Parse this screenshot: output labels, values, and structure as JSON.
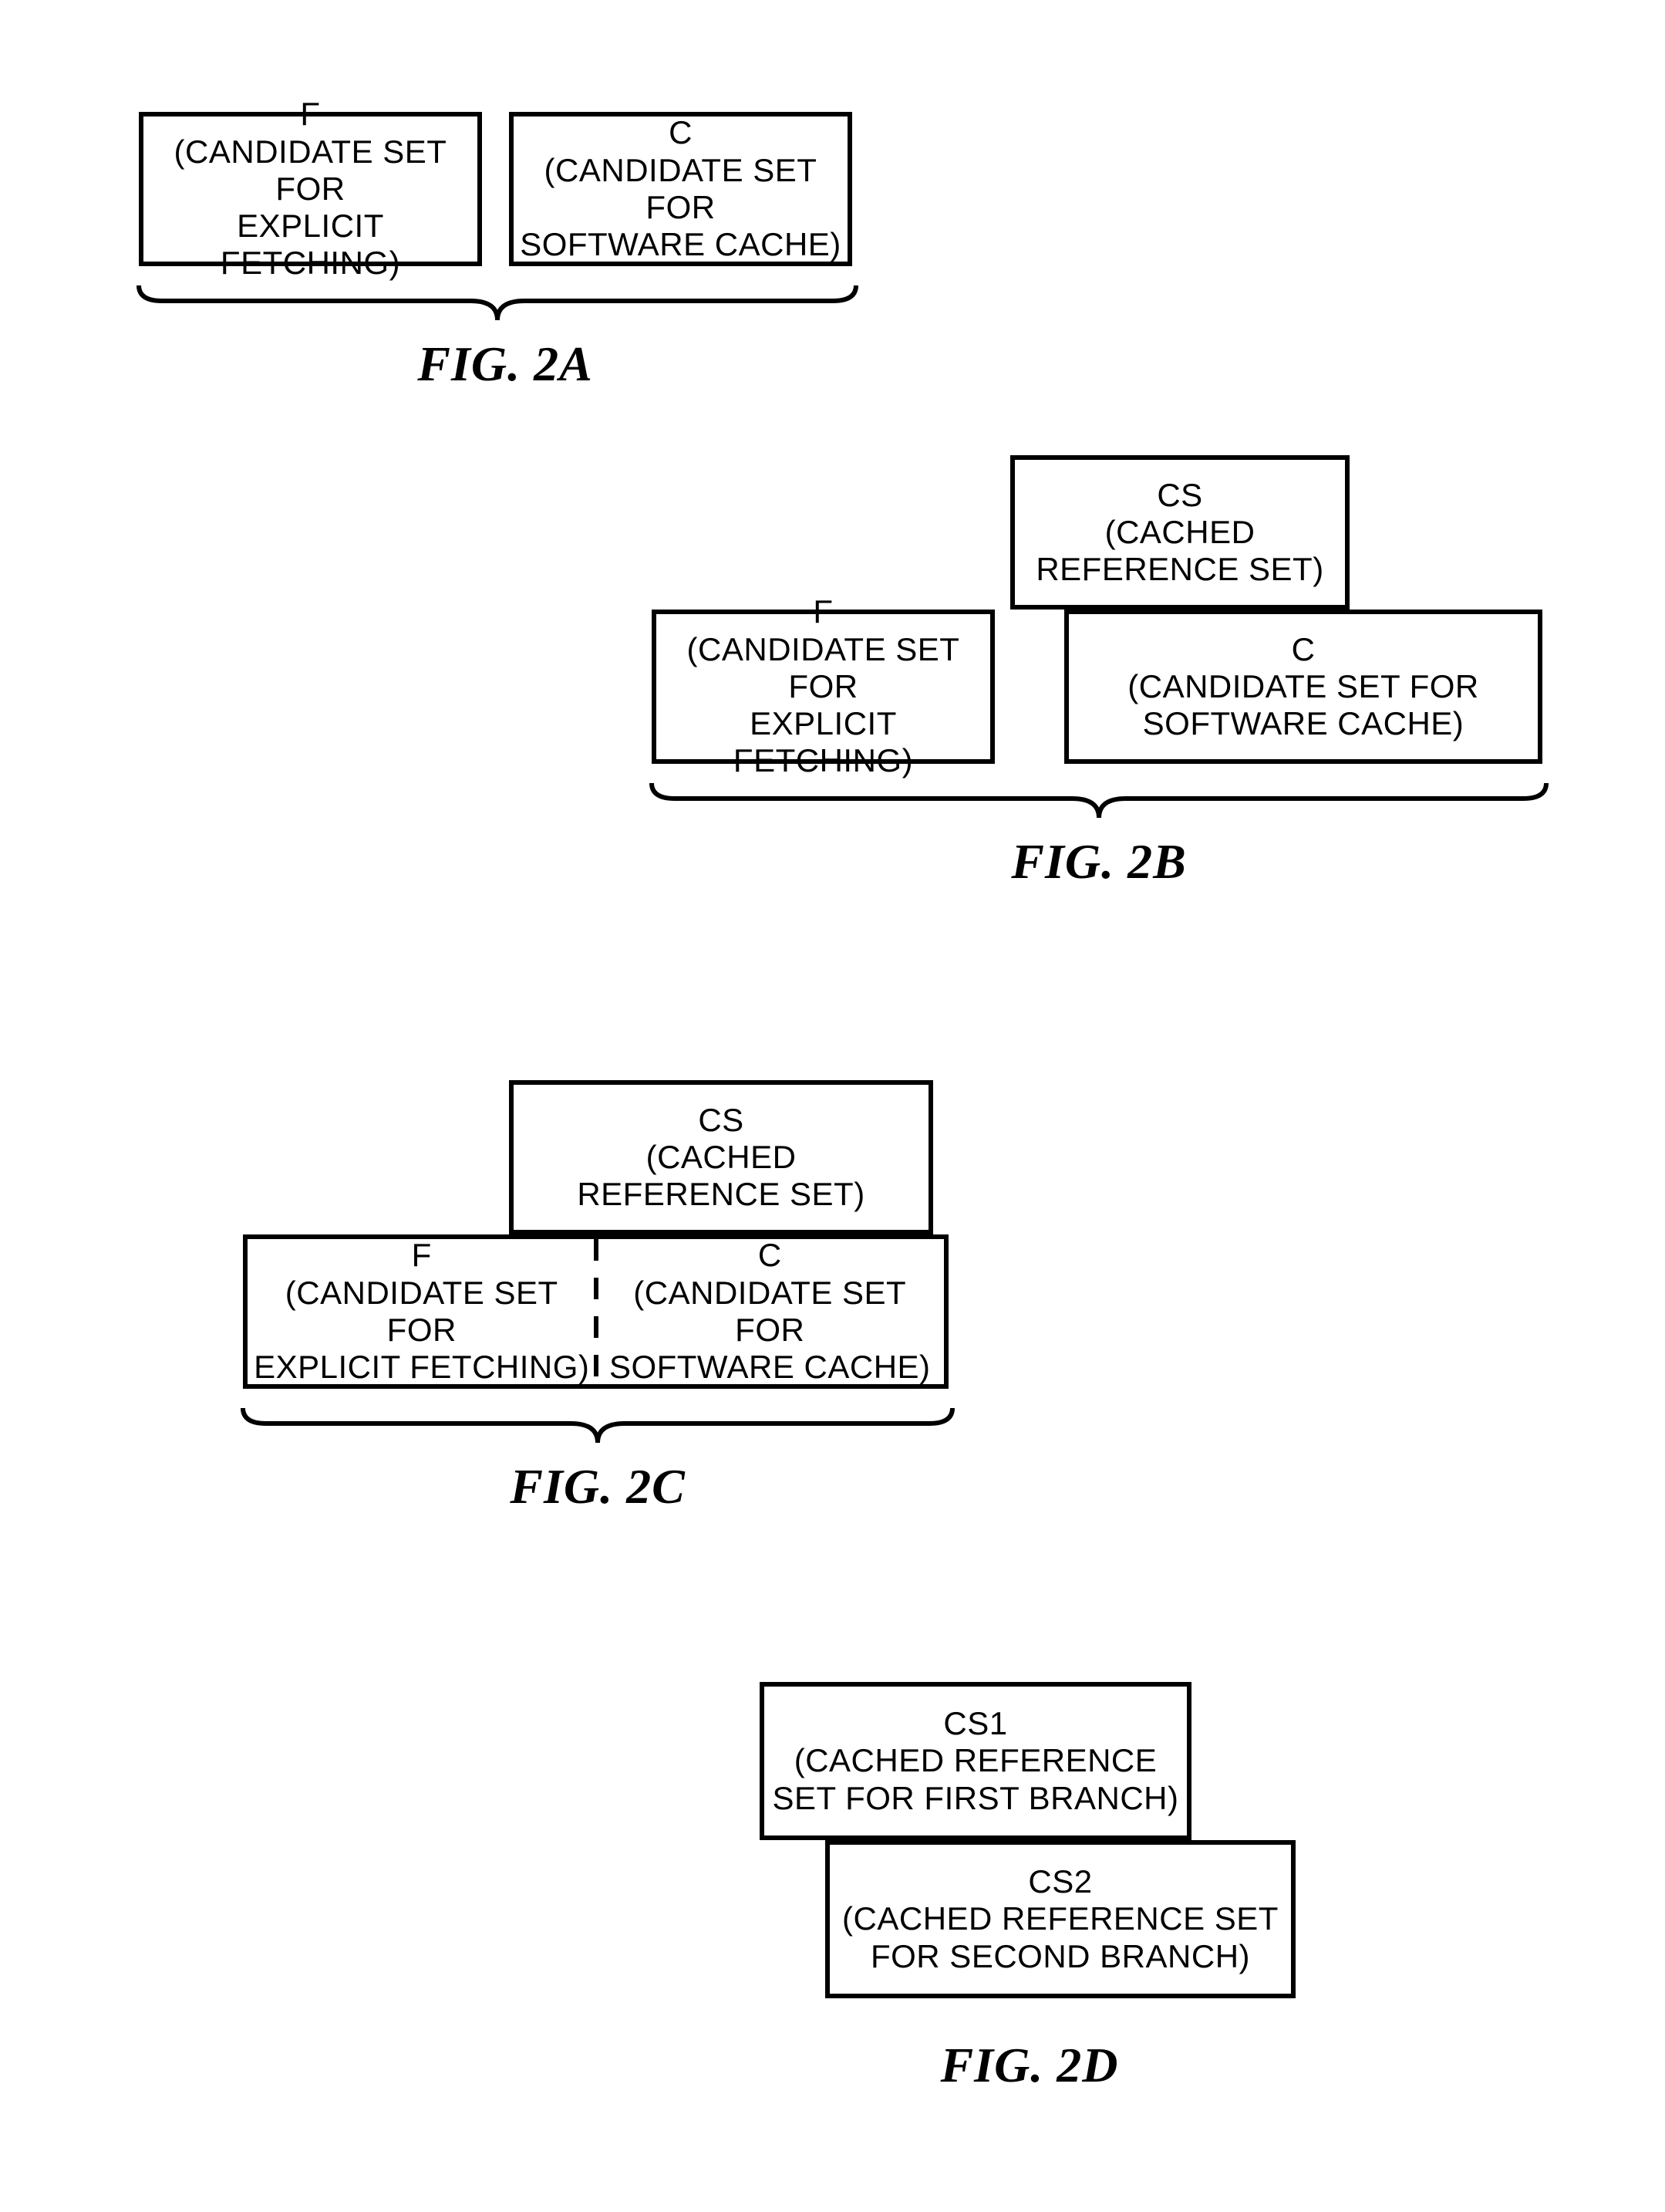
{
  "fig2a": {
    "caption": "FIG. 2A",
    "boxF": {
      "title": "F",
      "sub": "(CANDIDATE SET FOR\nEXPLICIT FETCHING)"
    },
    "boxC": {
      "title": "C",
      "sub": "(CANDIDATE SET FOR\nSOFTWARE CACHE)"
    }
  },
  "fig2b": {
    "caption": "FIG. 2B",
    "boxCS": {
      "title": "CS",
      "sub": "(CACHED\nREFERENCE SET)"
    },
    "boxF": {
      "title": "F",
      "sub": "(CANDIDATE SET FOR\nEXPLICIT FETCHING)"
    },
    "boxC": {
      "title": "C",
      "sub": "(CANDIDATE SET FOR\nSOFTWARE CACHE)"
    }
  },
  "fig2c": {
    "caption": "FIG. 2C",
    "boxCS": {
      "title": "CS",
      "sub": "(CACHED\nREFERENCE SET)"
    },
    "boxF": {
      "title": "F",
      "sub": "(CANDIDATE SET FOR\nEXPLICIT FETCHING)"
    },
    "boxC": {
      "title": "C",
      "sub": "(CANDIDATE SET FOR\nSOFTWARE CACHE)"
    }
  },
  "fig2d": {
    "caption": "FIG. 2D",
    "boxCS1": {
      "title": "CS1",
      "sub": "(CACHED REFERENCE\nSET FOR FIRST BRANCH)"
    },
    "boxCS2": {
      "title": "CS2",
      "sub": "(CACHED REFERENCE SET\nFOR SECOND BRANCH)"
    }
  }
}
